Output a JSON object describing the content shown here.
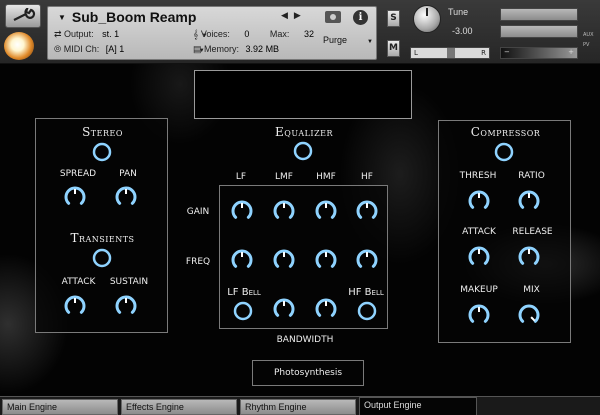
{
  "header": {
    "instrument_name": "Sub_Boom Reamp",
    "output_label": "Output:",
    "output_value": "st. 1",
    "voices_label": "Voices:",
    "voices_value": "0",
    "max_label": "Max:",
    "max_value": "32",
    "midi_label": "MIDI Ch:",
    "midi_value": "[A]  1",
    "memory_label": "Memory:",
    "memory_value": "3.92 MB",
    "purge_label": "Purge",
    "solo_label": "S",
    "mute_label": "M",
    "tune_label": "Tune",
    "tune_value": "-3.00",
    "pan_left": "L",
    "pan_right": "R",
    "aux_label": "AUX",
    "pv_label": "PV"
  },
  "stereo": {
    "title": "Stereo",
    "spread_label": "SPREAD",
    "pan_label": "PAN",
    "transients_title": "Transients",
    "attack_label": "ATTACK",
    "sustain_label": "SUSTAIN"
  },
  "equalizer": {
    "title": "Equalizer",
    "bands": [
      "LF",
      "LMF",
      "HMF",
      "HF"
    ],
    "gain_label": "GAIN",
    "freq_label": "FREQ",
    "lf_bell": "LF Bell",
    "hf_bell": "HF Bell",
    "bandwidth_label": "BANDWIDTH"
  },
  "compressor": {
    "title": "Compressor",
    "thresh_label": "THRESH",
    "ratio_label": "RATIO",
    "attack_label": "ATTACK",
    "release_label": "RELEASE",
    "makeup_label": "MAKEUP",
    "mix_label": "MIX"
  },
  "photosynthesis_label": "Photosynthesis",
  "tabs": [
    {
      "label": "Main Engine",
      "active": false
    },
    {
      "label": "Effects Engine",
      "active": false
    },
    {
      "label": "Rhythm Engine",
      "active": false
    },
    {
      "label": "Output Engine",
      "active": true
    }
  ],
  "knob_values": {
    "stereo_spread": 0.5,
    "stereo_pan": 0.5,
    "transient_attack": 0.5,
    "transient_sustain": 0.5,
    "eq_gain_lf": 0.5,
    "eq_gain_lmf": 0.5,
    "eq_gain_hmf": 0.5,
    "eq_gain_hf": 0.5,
    "eq_freq_lf": 0.5,
    "eq_freq_lmf": 0.5,
    "eq_freq_hmf": 0.5,
    "eq_freq_hf": 0.5,
    "eq_bw_lmf": 0.5,
    "eq_bw_hmf": 0.5,
    "comp_thresh": 0.5,
    "comp_ratio": 0.5,
    "comp_attack": 0.5,
    "comp_release": 0.5,
    "comp_makeup": 0.5,
    "comp_mix": 1.0
  },
  "colors": {
    "accent": "#8fd3ff",
    "panel_border": "#7a7a7a",
    "background": "#030303"
  }
}
